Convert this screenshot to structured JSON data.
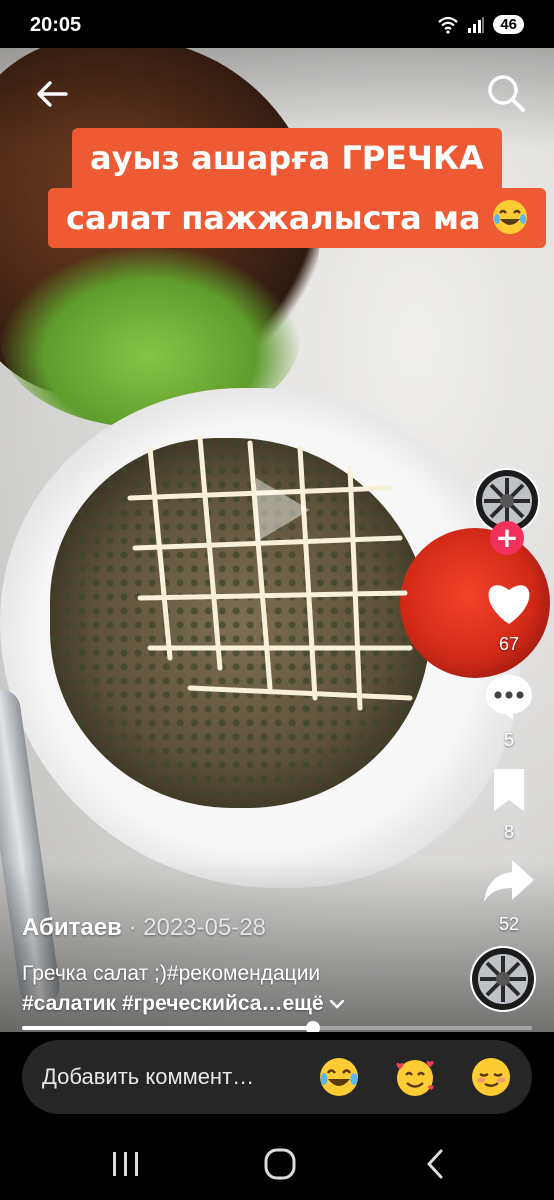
{
  "status_bar": {
    "time": "20:05",
    "battery": "46"
  },
  "caption": {
    "line1": "ауыз ашарға ГРЕЧКА",
    "line2": "салат пажжалыста ма"
  },
  "actions": {
    "likes": "67",
    "comments": "5",
    "saves": "8",
    "shares": "52"
  },
  "post": {
    "author": "Абитаев",
    "date": "· 2023-05-28",
    "desc_line1": "Гречка салат ;)#рекомендации",
    "desc_line2": "#салатик #греческийса…",
    "more": "ещё",
    "progress": 0.57
  },
  "comment": {
    "placeholder": "Добавить коммент…",
    "quick_emojis": [
      "tears-of-joy-emoji",
      "smiling-face-with-hearts-emoji",
      "relieved-face-emoji"
    ]
  },
  "colors": {
    "sticker": "#ee5a34",
    "follow": "#f1305c",
    "comment_bg": "#262626"
  }
}
